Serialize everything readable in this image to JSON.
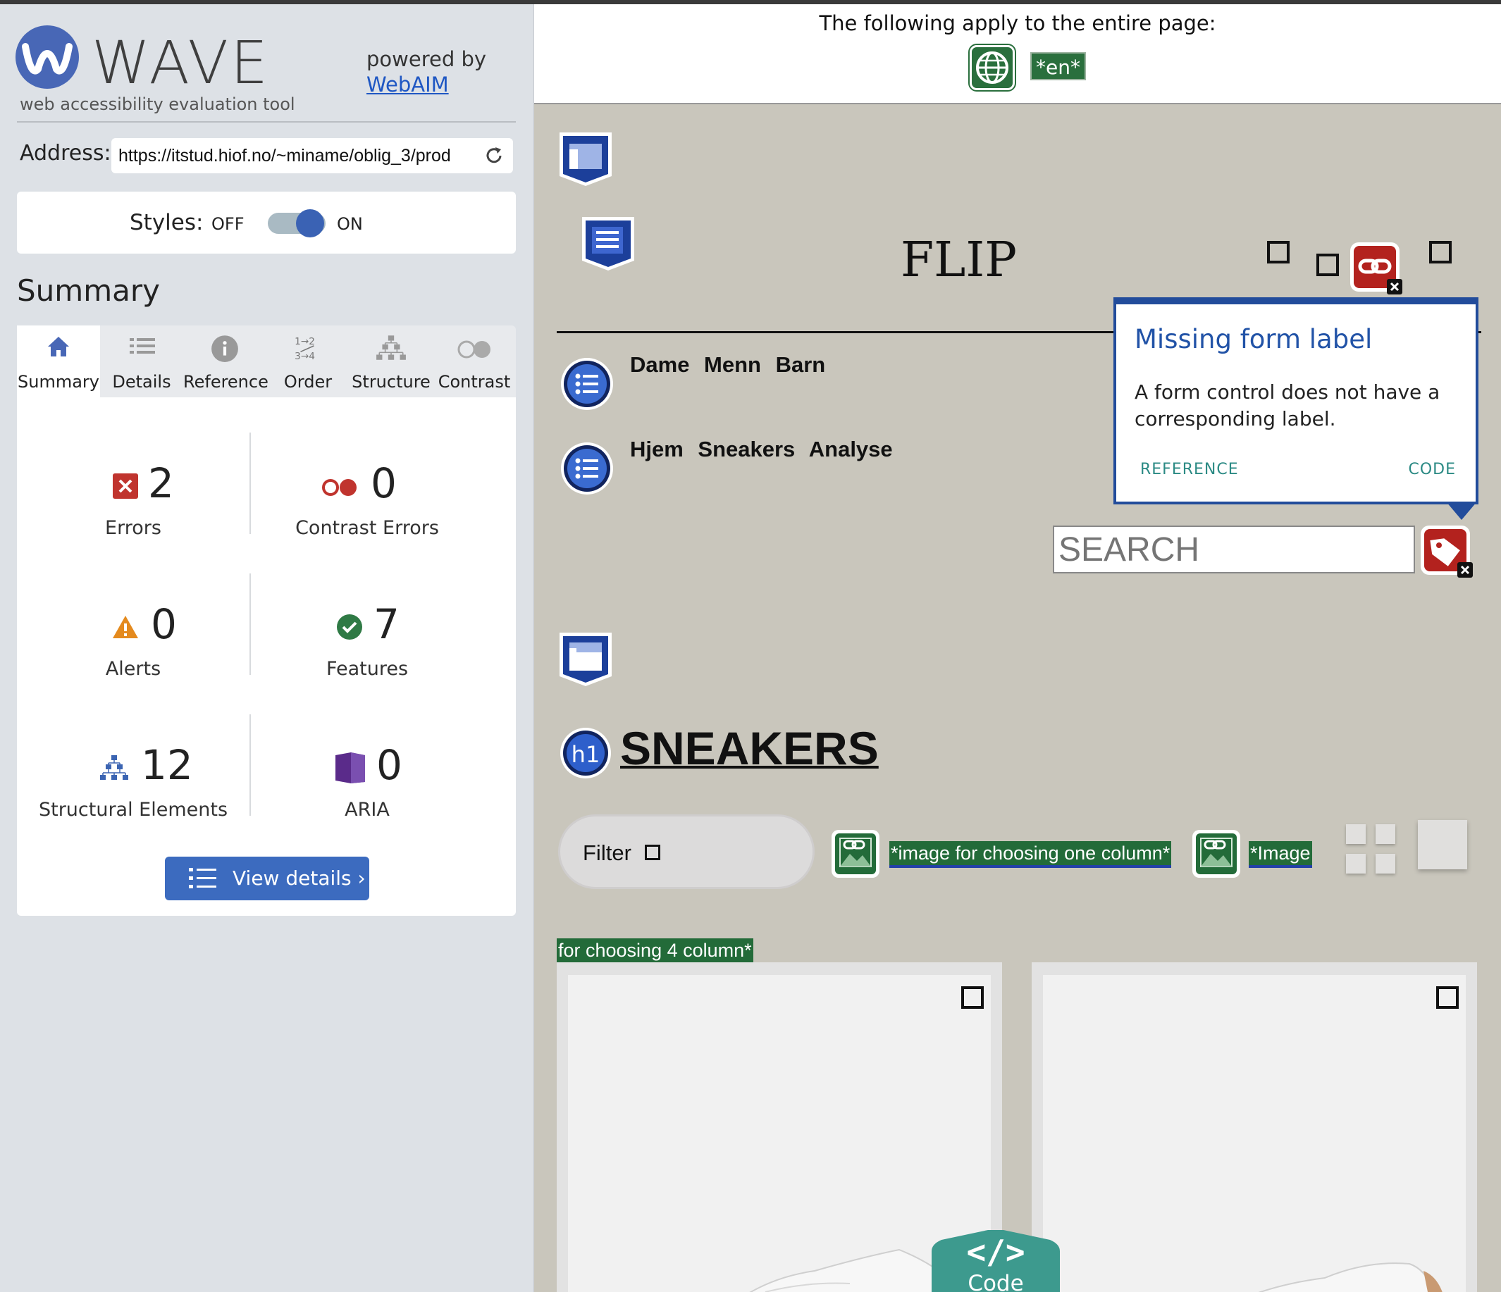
{
  "sidebar": {
    "logo_text": "WAVE",
    "tagline": "web accessibility evaluation tool",
    "powered_by": "powered by",
    "powered_link": "WebAIM",
    "address_label": "Address:",
    "address_value": "https://itstud.hiof.no/~miname/oblig_3/prod",
    "styles_label": "Styles:",
    "styles_off": "OFF",
    "styles_on": "ON",
    "styles_state": "on",
    "summary_heading": "Summary",
    "tabs": [
      {
        "label": "Summary",
        "icon": "home-icon",
        "active": true
      },
      {
        "label": "Details",
        "icon": "details-list-icon"
      },
      {
        "label": "Reference",
        "icon": "info-icon"
      },
      {
        "label": "Order",
        "icon": "order-icon"
      },
      {
        "label": "Structure",
        "icon": "structure-icon"
      },
      {
        "label": "Contrast",
        "icon": "contrast-icon"
      }
    ],
    "order_icon_text": "1→2\n3→4",
    "stats": {
      "errors": {
        "count": "2",
        "label": "Errors",
        "color": "#c0342e"
      },
      "contrast_errors": {
        "count": "0",
        "label": "Contrast Errors",
        "color": "#c0342e"
      },
      "alerts": {
        "count": "0",
        "label": "Alerts",
        "color": "#e48a1e"
      },
      "features": {
        "count": "7",
        "label": "Features",
        "color": "#2f7a45"
      },
      "structural": {
        "count": "12",
        "label": "Structural Elements",
        "color": "#3b64b2"
      },
      "aria": {
        "count": "0",
        "label": "ARIA",
        "color": "#5a2b8a"
      }
    },
    "view_details": "View details ›"
  },
  "content": {
    "banner_text": "The following apply to the entire page:",
    "language_badge": "*en*",
    "site_title": "FLIP",
    "nav_rows": [
      "Dame  Menn  Barn",
      "Hjem  Sneakers  Analyse"
    ],
    "popup": {
      "title": "Missing form label",
      "description": "A form control does not have a corresponding label.",
      "reference": "REFERENCE",
      "code": "CODE"
    },
    "search_placeholder": "SEARCH",
    "h1_badge": "h1",
    "heading": "SNEAKERS",
    "filter_label": "Filter",
    "alt_one_column": "*image for choosing one column*",
    "alt_four_column_a": "*Image",
    "alt_four_column_b": "for choosing 4 column*",
    "code_toggle": "Code",
    "code_symbol": "</>"
  },
  "colors": {
    "wave_blue": "#4867b6",
    "feature_green": "#2a6f3d",
    "error_red": "#c0342e",
    "structure_blue": "#1c3f9a",
    "popup_border": "#224c9b",
    "code_teal": "#3d9a8e"
  }
}
